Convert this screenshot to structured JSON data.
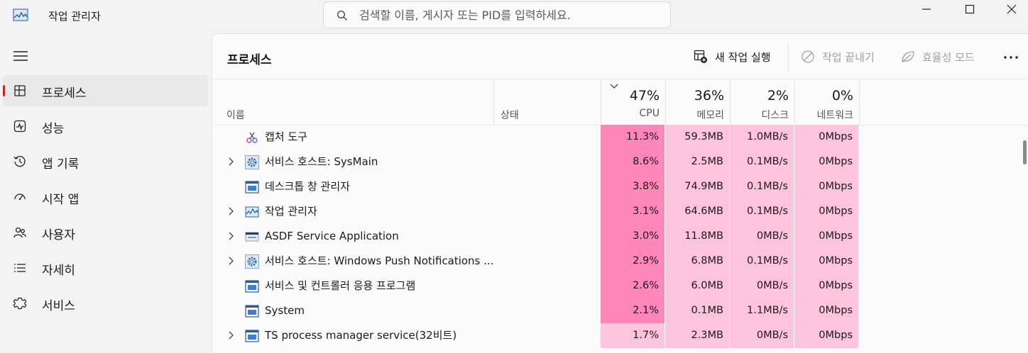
{
  "app": {
    "title": "작업 관리자"
  },
  "search": {
    "placeholder": "검색할 이름, 게시자 또는 PID를 입력하세요."
  },
  "nav": {
    "items": [
      {
        "label": "프로세스",
        "icon": "processes-icon",
        "active": true
      },
      {
        "label": "성능",
        "icon": "performance-icon"
      },
      {
        "label": "앱 기록",
        "icon": "app-history-icon"
      },
      {
        "label": "시작 앱",
        "icon": "startup-apps-icon"
      },
      {
        "label": "사용자",
        "icon": "users-icon"
      },
      {
        "label": "자세히",
        "icon": "details-icon"
      },
      {
        "label": "서비스",
        "icon": "services-icon"
      }
    ]
  },
  "panel": {
    "title": "프로세스",
    "commands": {
      "new_task": "새 작업 실행",
      "end_task": "작업 끝내기",
      "efficiency": "효율성 모드"
    }
  },
  "columns": {
    "name": "이름",
    "status": "상태",
    "cpu": {
      "pct": "47%",
      "label": "CPU"
    },
    "memory": {
      "pct": "36%",
      "label": "메모리"
    },
    "disk": {
      "pct": "2%",
      "label": "디스크"
    },
    "network": {
      "pct": "0%",
      "label": "네트워크"
    }
  },
  "colors": {
    "cpu_heat_high": "#ff86b8",
    "cpu_heat_low": "#ffc4dd",
    "active_indicator": "#c42b1c"
  },
  "processes": [
    {
      "name": "캡처 도구",
      "icon": "snipping-tool-icon",
      "expandable": false,
      "cpu": "11.3%",
      "memory": "59.3MB",
      "disk": "1.0MB/s",
      "network": "0Mbps"
    },
    {
      "name": "서비스 호스트: SysMain",
      "icon": "gear-icon",
      "expandable": true,
      "cpu": "8.6%",
      "memory": "2.5MB",
      "disk": "0.1MB/s",
      "network": "0Mbps"
    },
    {
      "name": "데스크톱 창 관리자",
      "icon": "window-icon",
      "expandable": false,
      "cpu": "3.8%",
      "memory": "74.9MB",
      "disk": "0.1MB/s",
      "network": "0Mbps"
    },
    {
      "name": "작업 관리자",
      "icon": "task-manager-icon",
      "expandable": true,
      "cpu": "3.1%",
      "memory": "64.6MB",
      "disk": "0.1MB/s",
      "network": "0Mbps"
    },
    {
      "name": "ASDF Service Application",
      "icon": "asus-app-icon",
      "expandable": true,
      "cpu": "3.0%",
      "memory": "11.8MB",
      "disk": "0MB/s",
      "network": "0Mbps"
    },
    {
      "name": "서비스 호스트: Windows Push Notifications ...",
      "icon": "gear-icon",
      "expandable": true,
      "cpu": "2.9%",
      "memory": "6.8MB",
      "disk": "0.1MB/s",
      "network": "0Mbps"
    },
    {
      "name": "서비스 및 컨트롤러 응용 프로그램",
      "icon": "window-icon",
      "expandable": false,
      "cpu": "2.6%",
      "memory": "6.0MB",
      "disk": "0MB/s",
      "network": "0Mbps"
    },
    {
      "name": "System",
      "icon": "window-icon",
      "expandable": false,
      "cpu": "2.1%",
      "memory": "0.1MB",
      "disk": "1.1MB/s",
      "network": "0Mbps"
    },
    {
      "name": "TS process manager service(32비트)",
      "icon": "window-icon",
      "expandable": true,
      "cpu": "1.7%",
      "memory": "2.3MB",
      "disk": "0MB/s",
      "network": "0Mbps"
    }
  ]
}
